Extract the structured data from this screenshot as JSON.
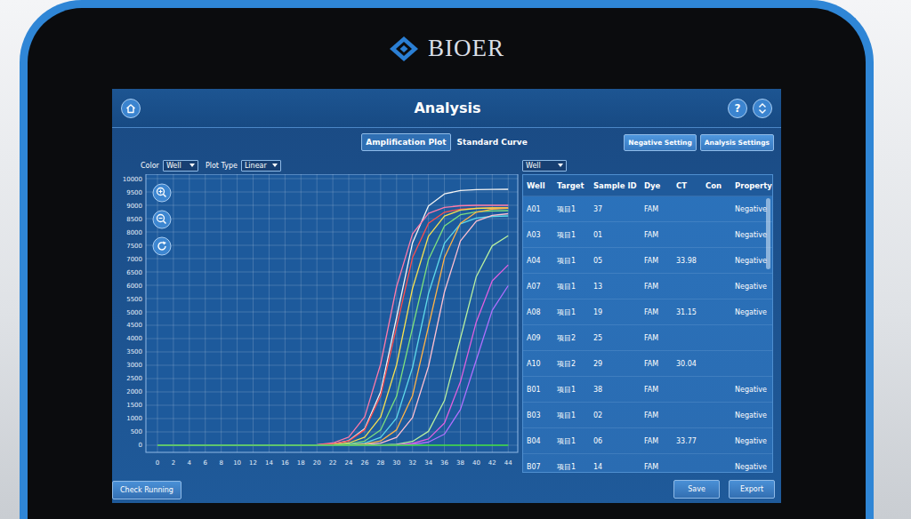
{
  "brand": {
    "name": "BIOER"
  },
  "window": {
    "title": "Analysis"
  },
  "help": {
    "label": "?"
  },
  "tabs": [
    {
      "label": "Amplification Plot",
      "selected": true
    },
    {
      "label": "Standard Curve",
      "selected": false
    }
  ],
  "actions": [
    "Negative Setting",
    "Analysis Settings"
  ],
  "plot_controls": [
    {
      "label": "Color",
      "value": "Well"
    },
    {
      "label": "Plot Type",
      "value": "Linear"
    }
  ],
  "chart": {
    "y_ticks": [
      "0",
      "500",
      "1000",
      "1500",
      "2000",
      "2500",
      "3000",
      "3500",
      "4000",
      "4500",
      "5000",
      "5500",
      "6000",
      "6500",
      "7000",
      "7500",
      "8000",
      "8500",
      "9000",
      "9500",
      "10000"
    ],
    "x_ticks": [
      "0",
      "2",
      "4",
      "6",
      "8",
      "10",
      "12",
      "14",
      "16",
      "18",
      "20",
      "22",
      "24",
      "26",
      "28",
      "30",
      "32",
      "34",
      "36",
      "38",
      "40",
      "42",
      "44"
    ],
    "series": [
      {
        "color": "#f4f4f4",
        "values": [
          0,
          0,
          0,
          0,
          0,
          0,
          0,
          0,
          0,
          0,
          12,
          46,
          173,
          624,
          2006,
          4800,
          7594,
          8976,
          9427,
          9552,
          9588,
          9597,
          9600
        ]
      },
      {
        "color": "#ff7aa8",
        "values": [
          0,
          0,
          0,
          0,
          0,
          0,
          0,
          0,
          0,
          6,
          23,
          84,
          306,
          1071,
          3051,
          5949,
          7929,
          8694,
          8919,
          8982,
          9000,
          9000,
          9000
        ]
      },
      {
        "color": "#ff4d4d",
        "values": [
          0,
          0,
          0,
          0,
          0,
          0,
          0,
          0,
          0,
          0,
          12,
          43,
          160,
          579,
          1860,
          4450,
          7040,
          8322,
          8740,
          8856,
          8891,
          8900,
          8900
        ]
      },
      {
        "color": "#f5e050",
        "values": [
          0,
          0,
          0,
          0,
          0,
          0,
          0,
          0,
          0,
          0,
          6,
          22,
          83,
          303,
          1059,
          3017,
          5883,
          7841,
          8597,
          8820,
          8882,
          8900,
          8900
        ]
      },
      {
        "color": "#7de07d",
        "values": [
          0,
          0,
          0,
          0,
          0,
          0,
          0,
          0,
          0,
          0,
          0,
          11,
          42,
          158,
          572,
          1839,
          4400,
          6961,
          8228,
          8642,
          8756,
          8791,
          8800
        ]
      },
      {
        "color": "#5fd8e8",
        "values": [
          0,
          0,
          0,
          0,
          0,
          0,
          0,
          0,
          0,
          0,
          0,
          6,
          22,
          80,
          292,
          1023,
          2915,
          5685,
          7577,
          8308,
          8523,
          8583,
          8600
        ]
      },
      {
        "color": "#ffb347",
        "values": [
          0,
          0,
          0,
          0,
          0,
          0,
          0,
          0,
          0,
          0,
          0,
          0,
          12,
          43,
          160,
          579,
          1860,
          4450,
          7040,
          8322,
          8740,
          8856,
          8891
        ]
      },
      {
        "color": "#ffc0d0",
        "values": [
          0,
          0,
          0,
          0,
          0,
          0,
          0,
          0,
          0,
          0,
          0,
          0,
          6,
          22,
          81,
          296,
          1035,
          2949,
          5751,
          7665,
          8404,
          8622,
          8683
        ]
      },
      {
        "color": "#b8f0a0",
        "values": [
          0,
          0,
          0,
          0,
          0,
          0,
          0,
          0,
          0,
          0,
          0,
          0,
          0,
          0,
          10,
          38,
          144,
          520,
          1672,
          4000,
          6328,
          7480,
          7856
        ]
      },
      {
        "color": "#e060e0",
        "values": [
          0,
          0,
          0,
          0,
          0,
          0,
          0,
          0,
          0,
          0,
          0,
          0,
          0,
          0,
          5,
          18,
          65,
          238,
          833,
          2373,
          4627,
          6167,
          6762
        ]
      },
      {
        "color": "#b070ff",
        "values": [
          0,
          0,
          0,
          0,
          0,
          0,
          0,
          0,
          0,
          0,
          0,
          0,
          0,
          0,
          0,
          8,
          31,
          115,
          416,
          1338,
          3200,
          5062,
          5984
        ]
      },
      {
        "color": "#40e040",
        "values": [
          0,
          0,
          0,
          0,
          0,
          0,
          0,
          0,
          0,
          0,
          0,
          0,
          0,
          0,
          0,
          0,
          0,
          0,
          0,
          0,
          0,
          0,
          0
        ]
      }
    ]
  },
  "table": {
    "filter": "Well",
    "columns": [
      "Well",
      "Target",
      "Sample ID",
      "Dye",
      "CT",
      "Con",
      "Property"
    ],
    "rows": [
      {
        "well": "A01",
        "target": "项目1",
        "sample_id": "37",
        "dye": "FAM",
        "ct": "",
        "con": "",
        "property": "Negative"
      },
      {
        "well": "A03",
        "target": "项目1",
        "sample_id": "01",
        "dye": "FAM",
        "ct": "",
        "con": "",
        "property": "Negative"
      },
      {
        "well": "A04",
        "target": "项目1",
        "sample_id": "05",
        "dye": "FAM",
        "ct": "33.98",
        "con": "",
        "property": "Negative"
      },
      {
        "well": "A07",
        "target": "项目1",
        "sample_id": "13",
        "dye": "FAM",
        "ct": "",
        "con": "",
        "property": "Negative"
      },
      {
        "well": "A08",
        "target": "项目1",
        "sample_id": "19",
        "dye": "FAM",
        "ct": "31.15",
        "con": "",
        "property": "Negative"
      },
      {
        "well": "A09",
        "target": "项目2",
        "sample_id": "25",
        "dye": "FAM",
        "ct": "",
        "con": "",
        "property": ""
      },
      {
        "well": "A10",
        "target": "项目2",
        "sample_id": "29",
        "dye": "FAM",
        "ct": "30.04",
        "con": "",
        "property": ""
      },
      {
        "well": "B01",
        "target": "项目1",
        "sample_id": "38",
        "dye": "FAM",
        "ct": "",
        "con": "",
        "property": "Negative"
      },
      {
        "well": "B03",
        "target": "项目1",
        "sample_id": "02",
        "dye": "FAM",
        "ct": "",
        "con": "",
        "property": "Negative"
      },
      {
        "well": "B04",
        "target": "项目1",
        "sample_id": "06",
        "dye": "FAM",
        "ct": "33.77",
        "con": "",
        "property": "Negative"
      },
      {
        "well": "B07",
        "target": "项目1",
        "sample_id": "14",
        "dye": "FAM",
        "ct": "",
        "con": "",
        "property": "Negative"
      }
    ]
  },
  "footer": {
    "left": [
      "Check Running"
    ],
    "right": [
      "Save",
      "Export"
    ]
  }
}
